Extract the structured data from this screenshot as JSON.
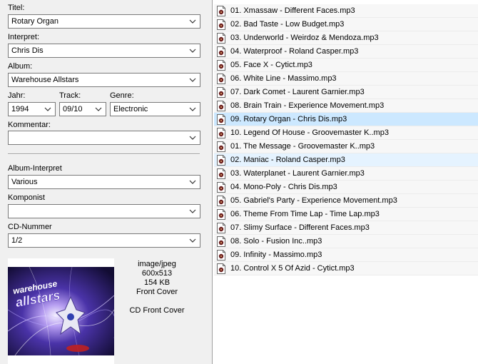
{
  "fields": {
    "title_label": "Titel:",
    "title_value": "Rotary Organ",
    "artist_label": "Interpret:",
    "artist_value": "Chris Dis",
    "album_label": "Album:",
    "album_value": "Warehouse Allstars",
    "year_label": "Jahr:",
    "year_value": "1994",
    "track_label": "Track:",
    "track_value": "09/10",
    "genre_label": "Genre:",
    "genre_value": "Electronic",
    "comment_label": "Kommentar:",
    "comment_value": "",
    "album_artist_label": "Album-Interpret",
    "album_artist_value": "Various",
    "composer_label": "Komponist",
    "composer_value": "",
    "cd_number_label": "CD-Nummer",
    "cd_number_value": "1/2"
  },
  "cover": {
    "mime": "image/jpeg",
    "dimensions": "600x513",
    "size": "154 KB",
    "type": "Front Cover",
    "description": "CD Front Cover",
    "art_text_top": "warehouse",
    "art_text_main": "allstars"
  },
  "colors": {
    "selected_row": "#cce8ff",
    "hover_row": "#e5f3ff",
    "cover_bg": "#1a1440"
  },
  "files": [
    {
      "name": "01. Xmassaw - Different Faces.mp3"
    },
    {
      "name": "02. Bad Taste - Low Budget.mp3"
    },
    {
      "name": "03. Underworld - Weirdoz & Mendoza.mp3"
    },
    {
      "name": "04. Waterproof - Roland Casper.mp3"
    },
    {
      "name": "05. Face X - Cytict.mp3"
    },
    {
      "name": "06. White Line - Massimo.mp3"
    },
    {
      "name": "07. Dark Comet - Laurent Garnier.mp3"
    },
    {
      "name": "08. Brain Train - Experience Movement.mp3"
    },
    {
      "name": "09. Rotary Organ - Chris Dis.mp3",
      "state": "selected"
    },
    {
      "name": "10. Legend Of House - Groovemaster K..mp3"
    },
    {
      "name": "01. The Message - Groovemaster K..mp3"
    },
    {
      "name": "02. Maniac - Roland Casper.mp3",
      "state": "hover"
    },
    {
      "name": "03. Waterplanet - Laurent Garnier.mp3"
    },
    {
      "name": "04. Mono-Poly - Chris Dis.mp3"
    },
    {
      "name": "05. Gabriel's Party - Experience Movement.mp3"
    },
    {
      "name": "06. Theme From Time Lap - Time Lap.mp3"
    },
    {
      "name": "07. Slimy Surface - Different Faces.mp3"
    },
    {
      "name": "08. Solo - Fusion Inc..mp3"
    },
    {
      "name": "09. Infinity - Massimo.mp3"
    },
    {
      "name": "10. Control X 5 Of Azid - Cytict.mp3"
    }
  ]
}
